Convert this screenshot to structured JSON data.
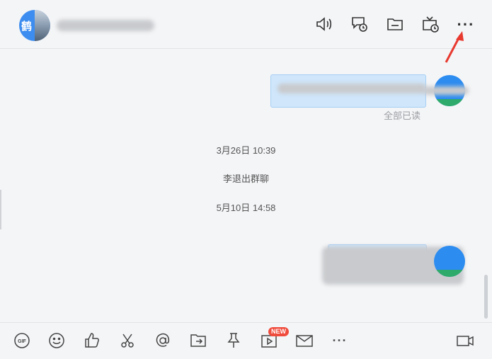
{
  "header": {
    "avatar_char": "鹤",
    "icons": [
      "speaker-icon",
      "chat-history-icon",
      "folder-icon",
      "tv-schedule-icon"
    ],
    "more_label": "···"
  },
  "messages": {
    "read_status": "全部已读",
    "timestamp1": "3月26日 10:39",
    "system_notice": "李退出群聊",
    "timestamp2": "5月10日 14:58"
  },
  "toolbar": {
    "icons": [
      "gif-icon",
      "emoji-icon",
      "thumbs-up-icon",
      "scissors-icon",
      "at-icon",
      "forward-file-icon",
      "pin-icon",
      "video-clip-icon",
      "mail-icon",
      "more-icon",
      "video-call-icon"
    ],
    "new_badge": "NEW",
    "more_label": "···"
  },
  "colors": {
    "background": "#f4f5f7",
    "bubble": "#cfe6fb",
    "accent": "#2c8cf0",
    "arrow": "#e8392f"
  }
}
